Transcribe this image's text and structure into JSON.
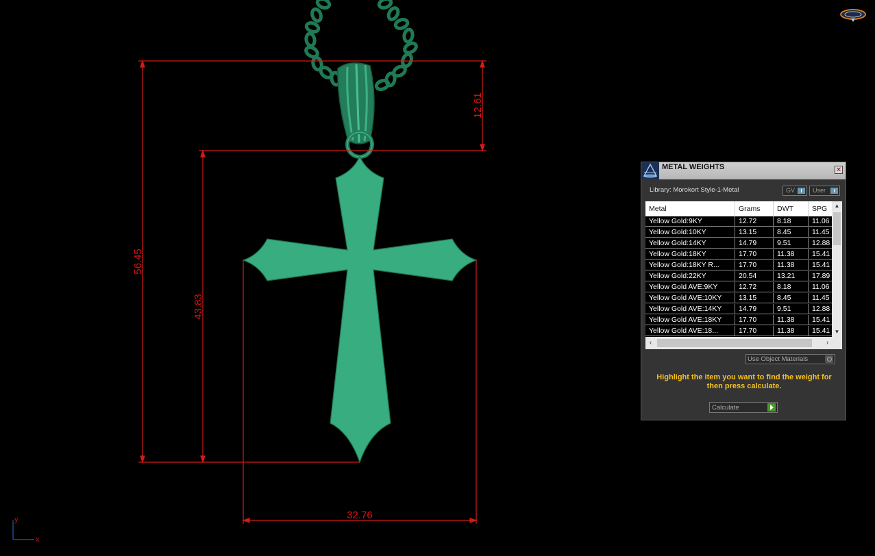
{
  "viewport": {
    "dimensions": {
      "overall_height": "56.45",
      "cross_height": "43.83",
      "bail_height": "12.61",
      "width": "32.76"
    },
    "axes": {
      "x": "x",
      "y": "y"
    },
    "colors": {
      "model": "#37ad80",
      "chain": "#1f7a55",
      "dimension": "#d11a1a",
      "background": "#000000"
    }
  },
  "panel": {
    "title": "METAL WEIGHTS",
    "close_icon": "close-icon",
    "library_label": "Library: Morokort Style-1-Metal",
    "toggle_gv": "GV",
    "toggle_user": "User",
    "columns": [
      "Metal",
      "Grams",
      "DWT",
      "SPG"
    ],
    "rows": [
      [
        "Yellow Gold:9KY",
        "12.72",
        "8.18",
        "11.06"
      ],
      [
        "Yellow Gold:10KY",
        "13.15",
        "8.45",
        "11.45"
      ],
      [
        "Yellow Gold:14KY",
        "14.79",
        "9.51",
        "12.88"
      ],
      [
        "Yellow Gold:18KY",
        "17.70",
        "11.38",
        "15.41"
      ],
      [
        "Yellow Gold:18KY R...",
        "17.70",
        "11.38",
        "15.41"
      ],
      [
        "Yellow Gold:22KY",
        "20.54",
        "13.21",
        "17.89"
      ],
      [
        "Yellow Gold AVE:9KY",
        "12.72",
        "8.18",
        "11.06"
      ],
      [
        "Yellow Gold AVE:10KY",
        "13.15",
        "8.45",
        "11.45"
      ],
      [
        "Yellow Gold AVE:14KY",
        "14.79",
        "9.51",
        "12.88"
      ],
      [
        "Yellow Gold AVE:18KY",
        "17.70",
        "11.38",
        "15.41"
      ],
      [
        "Yellow Gold AVE:18...",
        "17.70",
        "11.38",
        "15.41"
      ]
    ],
    "use_object_materials": "Use Object Materials",
    "hint": "Highlight the item you want to find the weight for then press calculate.",
    "calculate": "Calculate",
    "accent": "#f4c020"
  }
}
